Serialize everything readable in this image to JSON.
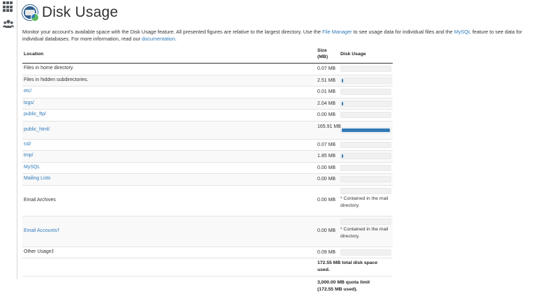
{
  "header": {
    "title": "Disk Usage"
  },
  "intro": {
    "part1": "Monitor your account's available space with the Disk Usage feature. All presented figures are relative to the largest directory. Use the ",
    "link_file_manager": "File Manager",
    "part2": " to see usage data for individual files and the ",
    "link_mysql": "MySQL",
    "part3": " feature to see data for individual databases. For more information, read our ",
    "link_docs": "documentation",
    "part4": "."
  },
  "table": {
    "headers": {
      "location": "Location",
      "size": "Size (MB)",
      "usage": "Disk Usage"
    },
    "rows": [
      {
        "location": "Files in home directory.",
        "size": "0.07 MB",
        "usage_fraction": 0.0004,
        "link": false
      },
      {
        "location": "Files in hidden subdirectories.",
        "size": "2.51 MB",
        "usage_fraction": 0.015,
        "link": false
      },
      {
        "location": "etc/",
        "size": "0.01 MB",
        "usage_fraction": 0.0001,
        "link": true
      },
      {
        "location": "logs/",
        "size": "2.04 MB",
        "usage_fraction": 0.012,
        "link": true
      },
      {
        "location": "public_ftp/",
        "size": "0.00 MB",
        "usage_fraction": 0,
        "link": true
      },
      {
        "location": "public_html/",
        "size": "165.91 MB",
        "usage_fraction": 1.0,
        "link": true
      },
      {
        "location": "ssl/",
        "size": "0.07 MB",
        "usage_fraction": 0.0004,
        "link": true
      },
      {
        "location": "tmp/",
        "size": "1.85 MB",
        "usage_fraction": 0.011,
        "link": true
      },
      {
        "location": "MySQL",
        "size": "0.00 MB",
        "usage_fraction": 0,
        "link": true
      },
      {
        "location": "Mailing Lists",
        "size": "0.00 MB",
        "usage_fraction": 0,
        "link": true
      },
      {
        "location": "Email Archives",
        "size": "0.00 MB",
        "usage_fraction": 0,
        "link": false,
        "note": "* Contained in the mail directory."
      },
      {
        "location": "Email Accounts†",
        "size": "0.00 MB",
        "usage_fraction": 0,
        "link": true,
        "note": "* Contained in the mail directory."
      },
      {
        "location": "Other Usage‡",
        "size": "0.09 MB",
        "usage_fraction": 0.0005,
        "link": false
      }
    ],
    "total": "172.55 MB total disk space used.",
    "quota": "3,000.00 MB quota limit (172.55 MB used)."
  },
  "colors": {
    "bar": "#337ab7",
    "link": "#2f7ab9"
  },
  "icons": {
    "rail_top": "grid-icon",
    "rail_second": "users-icon",
    "logo": "disk-usage-logo-icon"
  }
}
